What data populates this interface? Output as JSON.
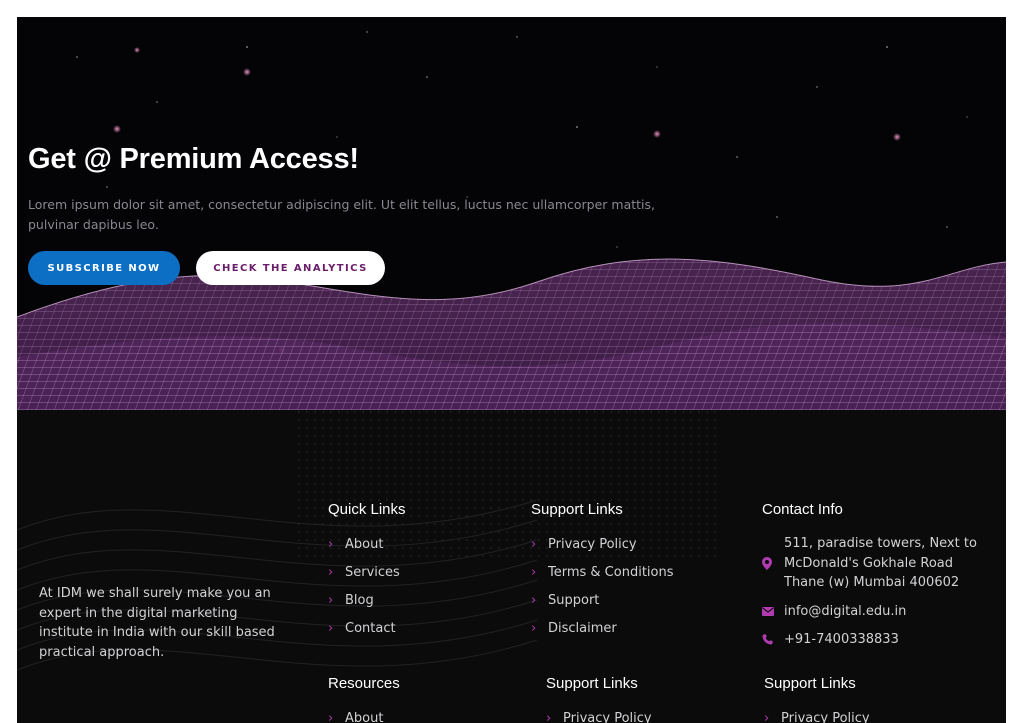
{
  "hero": {
    "title": "Get @ Premium Access!",
    "subtitle": "Lorem ipsum dolor sit amet, consectetur adipiscing elit. Ut elit tellus, luctus nec ullamcorper mattis, pulvinar dapibus leo.",
    "subscribe_label": "SUBSCRIBE NOW",
    "analytics_label": "CHECK THE ANALYTICS"
  },
  "footer": {
    "about_text": "At IDM we shall surely make you an expert in the digital marketing institute in India with our skill based practical approach.",
    "quick_links": {
      "title": "Quick Links",
      "items": [
        "About",
        "Services",
        "Blog",
        "Contact"
      ]
    },
    "support_links": {
      "title": "Support Links",
      "items": [
        "Privacy Policy",
        "Terms & Conditions",
        "Support",
        "Disclaimer"
      ]
    },
    "contact": {
      "title": "Contact Info",
      "address": "511, paradise towers, Next to McDonald's Gokhale Road Thane (w) Mumbai 400602",
      "email": "info@digital.edu.in",
      "phone": "+91-7400338833"
    },
    "resources": {
      "title": "Resources",
      "items": [
        "About"
      ]
    },
    "support_links_2": {
      "title": "Support Links",
      "items": [
        "Privacy Policy"
      ]
    },
    "support_links_3": {
      "title": "Support Links",
      "items": [
        "Privacy Policy"
      ]
    }
  },
  "colors": {
    "subscribe_button": "#0c6fc4",
    "analytics_text": "#6b1d6b",
    "icon_accent": "#b13bb1",
    "footer_bg": "#0b0b0c"
  },
  "icons": {
    "link_bullet": "chevron-right-icon",
    "address": "map-pin-icon",
    "email": "envelope-icon",
    "phone": "phone-icon"
  }
}
